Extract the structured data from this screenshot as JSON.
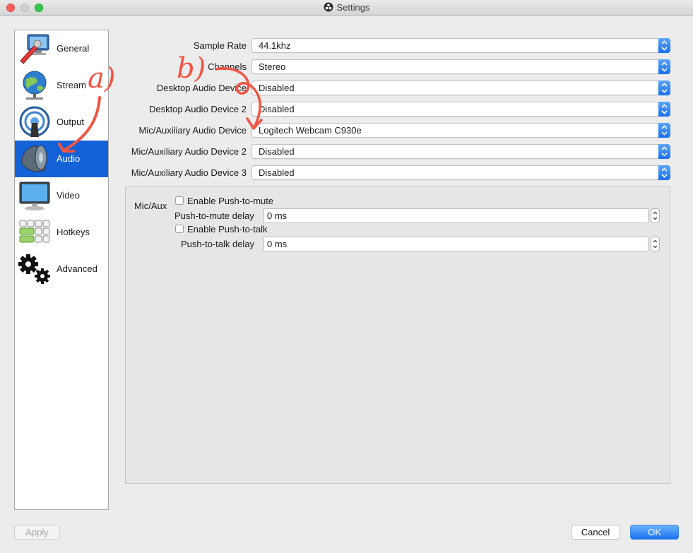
{
  "window": {
    "title": "Settings"
  },
  "sidebar": {
    "items": [
      {
        "label": "General",
        "icon": "general-icon"
      },
      {
        "label": "Stream",
        "icon": "stream-icon"
      },
      {
        "label": "Output",
        "icon": "output-icon"
      },
      {
        "label": "Audio",
        "icon": "audio-icon",
        "selected": true
      },
      {
        "label": "Video",
        "icon": "video-icon"
      },
      {
        "label": "Hotkeys",
        "icon": "hotkeys-icon"
      },
      {
        "label": "Advanced",
        "icon": "advanced-icon"
      }
    ]
  },
  "audio": {
    "fields": [
      {
        "label": "Sample Rate",
        "value": "44.1khz"
      },
      {
        "label": "Channels",
        "value": "Stereo"
      },
      {
        "label": "Desktop Audio Device",
        "value": "Disabled"
      },
      {
        "label": "Desktop Audio Device 2",
        "value": "Disabled"
      },
      {
        "label": "Mic/Auxiliary Audio Device",
        "value": "Logitech Webcam C930e"
      },
      {
        "label": "Mic/Auxiliary Audio Device 2",
        "value": "Disabled"
      },
      {
        "label": "Mic/Auxiliary Audio Device 3",
        "value": "Disabled"
      }
    ],
    "group": {
      "name": "Mic/Aux",
      "push_to_mute": {
        "label": "Enable Push-to-mute",
        "checked": false
      },
      "push_to_mute_delay": {
        "label": "Push-to-mute delay",
        "value": "0 ms"
      },
      "push_to_talk": {
        "label": "Enable Push-to-talk",
        "checked": false
      },
      "push_to_talk_delay": {
        "label": "Push-to-talk delay",
        "value": "0 ms"
      }
    }
  },
  "annotations": {
    "a": "a)",
    "b": "b)"
  },
  "footer": {
    "apply": "Apply",
    "cancel": "Cancel",
    "ok": "OK"
  },
  "colors": {
    "accent": "#1462d7",
    "annotation": "#f25544"
  }
}
